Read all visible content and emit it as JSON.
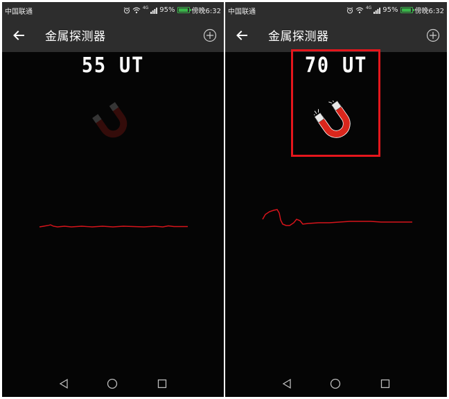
{
  "screens": [
    {
      "status": {
        "carrier": "中国联通",
        "network": "4G",
        "battery_pct": "95%",
        "battery_level": 0.95,
        "time": "傍晚6:32"
      },
      "appbar": {
        "title": "金属探测器"
      },
      "reading": "55 UT",
      "highlighted": false,
      "magnet_active": false
    },
    {
      "status": {
        "carrier": "中国联通",
        "network": "4G",
        "battery_pct": "95%",
        "battery_level": 0.95,
        "time": "傍晚6:32"
      },
      "appbar": {
        "title": "金属探测器"
      },
      "reading": "70 UT",
      "highlighted": true,
      "magnet_active": true
    }
  ],
  "icons": {
    "back": "arrow-left-icon",
    "add": "add-circle-icon",
    "magnet": "magnet-icon",
    "nav_back": "triangle-back-icon",
    "nav_home": "circle-home-icon",
    "nav_recent": "square-recent-icon"
  },
  "colors": {
    "background": "#050505",
    "bar": "#2d2d2d",
    "graph_line": "#d8141b",
    "highlight": "#e5161c",
    "magnet_red": "#d9261c",
    "battery": "#3ab54a"
  }
}
